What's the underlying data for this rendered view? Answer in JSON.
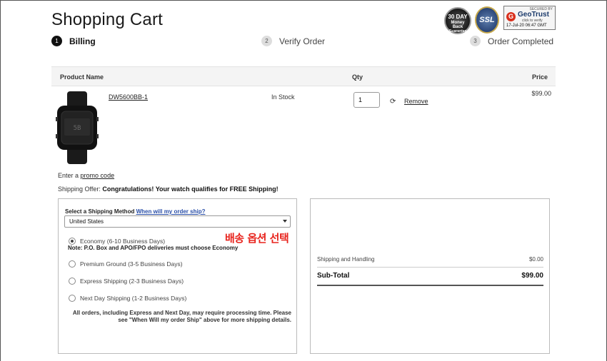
{
  "page": {
    "title": "Shopping Cart"
  },
  "badges": {
    "money_back_top": "30 DAY",
    "money_back_mid": "Money Back",
    "money_back_bot": "Guarantee",
    "ssl": "SSL",
    "geotrust_top": "SECURED BY",
    "geotrust_name": "GeoTrust",
    "geotrust_sub": "click to verify",
    "geotrust_date": "17-Jul-20 06:47 GMT"
  },
  "steps": [
    {
      "num": "1",
      "label": "Billing"
    },
    {
      "num": "2",
      "label": "Verify Order"
    },
    {
      "num": "3",
      "label": "Order Completed"
    }
  ],
  "table": {
    "col_name": "Product Name",
    "col_qty": "Qty",
    "col_price": "Price"
  },
  "item": {
    "name": "DW5600BB-1",
    "stock": "In Stock",
    "qty": "1",
    "remove": "Remove",
    "price": "$99.00",
    "watch_display": "5B"
  },
  "promo": {
    "prefix": "Enter a",
    "link": "promo code"
  },
  "offer": {
    "prefix": "Shipping Offer:",
    "message": "Congratulations! Your watch qualifies for FREE Shipping!"
  },
  "shipping": {
    "label": "Select a Shipping Method",
    "link": "When will my order ship?",
    "country": "United States",
    "options": [
      "Economy (6-10 Business Days)",
      "Premium Ground (3-5 Business Days)",
      "Express Shipping (2-3 Business Days)",
      "Next Day Shipping (1-2 Business Days)"
    ],
    "economy_note": "Note: P.O. Box and APO/FPO deliveries must choose Economy",
    "annotation": "배송 옵션 선택",
    "disclaimer": "All orders, including Express and Next Day, may require processing time. Please see \"When Will my order Ship\" above for more shipping details."
  },
  "summary": {
    "shipping_label": "Shipping and Handling",
    "shipping_value": "$0.00",
    "subtotal_label": "Sub-Total",
    "subtotal_value": "$99.00"
  },
  "colors": {
    "accent_link": "#2a4fa8",
    "annotation": "#e8241d",
    "header_bg": "#f4f4f4"
  }
}
